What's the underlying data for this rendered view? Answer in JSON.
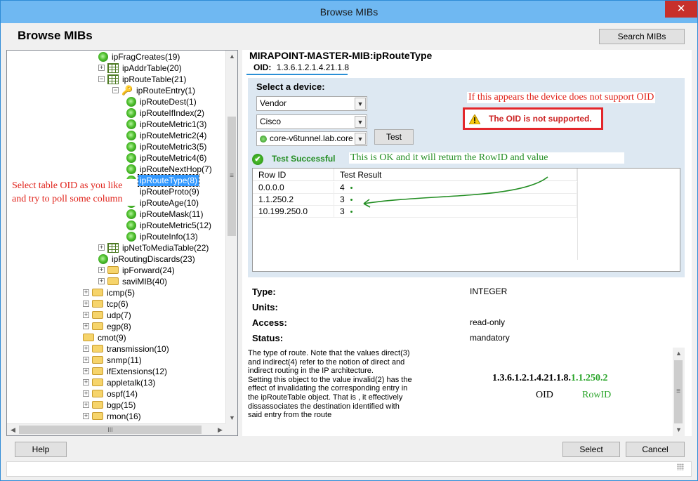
{
  "window": {
    "title": "Browse MIBs",
    "close_glyph": "✕"
  },
  "header": {
    "title": "Browse MIBs",
    "search_button": "Search MIBs"
  },
  "tree": {
    "items": [
      {
        "label": "ipFragCreates(19)",
        "icon": "leaf-icon",
        "depth": 2,
        "expander": ""
      },
      {
        "label": "ipAddrTable(20)",
        "icon": "table-icon",
        "depth": 2,
        "expander": "+"
      },
      {
        "label": "ipRouteTable(21)",
        "icon": "table-icon",
        "depth": 2,
        "expander": "−"
      },
      {
        "label": "ipRouteEntry(1)",
        "icon": "key-icon",
        "depth": 3,
        "expander": "−"
      },
      {
        "label": "ipRouteDest(1)",
        "icon": "leaf-icon",
        "depth": 4,
        "expander": ""
      },
      {
        "label": "ipRouteIfIndex(2)",
        "icon": "leaf-icon",
        "depth": 4,
        "expander": ""
      },
      {
        "label": "ipRouteMetric1(3)",
        "icon": "leaf-icon",
        "depth": 4,
        "expander": ""
      },
      {
        "label": "ipRouteMetric2(4)",
        "icon": "leaf-icon",
        "depth": 4,
        "expander": ""
      },
      {
        "label": "ipRouteMetric3(5)",
        "icon": "leaf-icon",
        "depth": 4,
        "expander": ""
      },
      {
        "label": "ipRouteMetric4(6)",
        "icon": "leaf-icon",
        "depth": 4,
        "expander": ""
      },
      {
        "label": "ipRouteNextHop(7)",
        "icon": "leaf-icon",
        "depth": 4,
        "expander": ""
      },
      {
        "label": "ipRouteType(8)",
        "icon": "leaf-icon",
        "depth": 4,
        "expander": "",
        "selected": true
      },
      {
        "label": "ipRouteProto(9)",
        "icon": "leaf-icon",
        "depth": 4,
        "expander": ""
      },
      {
        "label": "ipRouteAge(10)",
        "icon": "leaf-icon",
        "depth": 4,
        "expander": ""
      },
      {
        "label": "ipRouteMask(11)",
        "icon": "leaf-icon",
        "depth": 4,
        "expander": ""
      },
      {
        "label": "ipRouteMetric5(12)",
        "icon": "leaf-icon",
        "depth": 4,
        "expander": ""
      },
      {
        "label": "ipRouteInfo(13)",
        "icon": "leaf-icon",
        "depth": 4,
        "expander": ""
      },
      {
        "label": "ipNetToMediaTable(22)",
        "icon": "table-icon",
        "depth": 2,
        "expander": "+"
      },
      {
        "label": "ipRoutingDiscards(23)",
        "icon": "leaf-icon",
        "depth": 2,
        "expander": ""
      },
      {
        "label": "ipForward(24)",
        "icon": "folder-icon",
        "depth": 2,
        "expander": "+"
      },
      {
        "label": "saviMIB(40)",
        "icon": "folder-icon",
        "depth": 2,
        "expander": "+"
      },
      {
        "label": "icmp(5)",
        "icon": "folder-icon",
        "depth": 1,
        "expander": "+"
      },
      {
        "label": "tcp(6)",
        "icon": "folder-icon",
        "depth": 1,
        "expander": "+"
      },
      {
        "label": "udp(7)",
        "icon": "folder-icon",
        "depth": 1,
        "expander": "+"
      },
      {
        "label": "egp(8)",
        "icon": "folder-icon",
        "depth": 1,
        "expander": "+"
      },
      {
        "label": "cmot(9)",
        "icon": "folder-icon",
        "depth": 1,
        "expander": ""
      },
      {
        "label": "transmission(10)",
        "icon": "folder-icon",
        "depth": 1,
        "expander": "+"
      },
      {
        "label": "snmp(11)",
        "icon": "folder-icon",
        "depth": 1,
        "expander": "+"
      },
      {
        "label": "ifExtensions(12)",
        "icon": "folder-icon",
        "depth": 1,
        "expander": "+"
      },
      {
        "label": "appletalk(13)",
        "icon": "folder-icon",
        "depth": 1,
        "expander": "+"
      },
      {
        "label": "ospf(14)",
        "icon": "folder-icon",
        "depth": 1,
        "expander": "+"
      },
      {
        "label": "bgp(15)",
        "icon": "folder-icon",
        "depth": 1,
        "expander": "+"
      },
      {
        "label": "rmon(16)",
        "icon": "folder-icon",
        "depth": 1,
        "expander": "+"
      }
    ],
    "hscroll_thumb": "III",
    "vscroll_thumb": "≡"
  },
  "annotations": {
    "left": "Select table OID as you like and try to poll some column",
    "red": "If this appears the device does not support OID",
    "green": "This is OK and it will return the RowID and value"
  },
  "mib": {
    "title": "MIRAPOINT-MASTER-MIB:ipRouteType",
    "oid_label": "OID:",
    "oid_value": "1.3.6.1.2.1.4.21.1.8"
  },
  "device": {
    "label": "Select a device:",
    "vendor": "Vendor",
    "model": "Cisco",
    "host": "core-v6tunnel.lab.core",
    "test_button": "Test",
    "error": "The OID is not supported.",
    "success": "Test Successful"
  },
  "results": {
    "columns": [
      "Row ID",
      "Test Result"
    ],
    "rows": [
      {
        "row_id": "0.0.0.0",
        "result": "4"
      },
      {
        "row_id": "1.1.250.2",
        "result": "3"
      },
      {
        "row_id": "10.199.250.0",
        "result": "3"
      }
    ]
  },
  "properties": {
    "type_label": "Type:",
    "type_value": "INTEGER",
    "units_label": "Units:",
    "units_value": "",
    "access_label": "Access:",
    "access_value": "read-only",
    "status_label": "Status:",
    "status_value": "mandatory"
  },
  "description": "The type of route. Note that the values direct(3) and indirect(4) refer to the notion of direct and indirect routing in the IP architecture.\nSetting this object to the value invalid(2) has the effect of invalidating the corresponding entry in the ipRouteTable object. That is , it effectively dissassociates the destination identified with said entry from the route",
  "oid_example": {
    "oid_part": "1.3.6.1.2.1.4.21.1.8.",
    "rowid_part": "1.1.250.2",
    "oid_caption": "OID",
    "rowid_caption": "RowID"
  },
  "footer": {
    "help": "Help",
    "select": "Select",
    "cancel": "Cancel"
  },
  "colors": {
    "accent": "#2a8fd6",
    "error_red": "#e3262b",
    "success_green": "#238e23",
    "selection": "#3399ff"
  }
}
